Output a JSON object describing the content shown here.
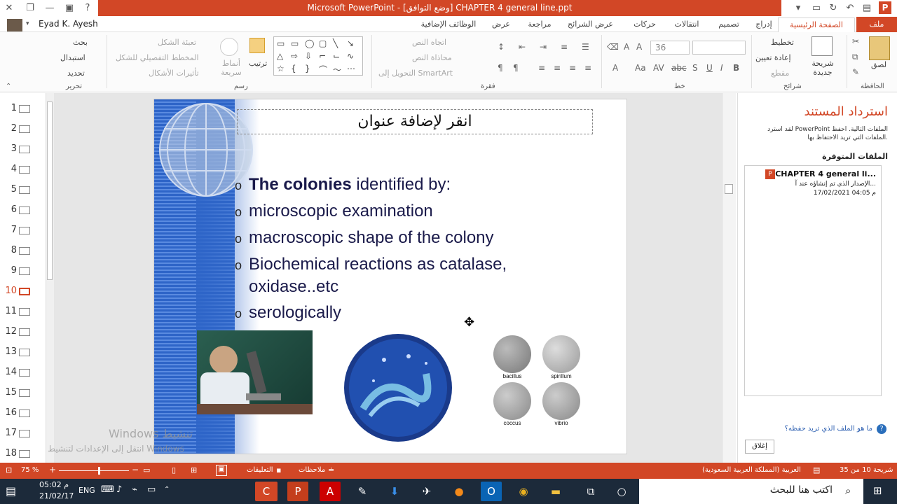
{
  "window": {
    "title": "Microsoft PowerPoint  - [وضع التوافق] CHAPTER  4 general line.ppt",
    "user": "Eyad K. Ayesh"
  },
  "tabs": [
    {
      "label": "ملف"
    },
    {
      "label": "الصفحة الرئيسية"
    },
    {
      "label": "إدراج"
    },
    {
      "label": "تصميم"
    },
    {
      "label": "انتقالات"
    },
    {
      "label": "حركات"
    },
    {
      "label": "عرض الشرائح"
    },
    {
      "label": "مراجعة"
    },
    {
      "label": "عرض"
    },
    {
      "label": "الوظائف الإضافية"
    }
  ],
  "ribbon": {
    "clipboard": {
      "paste": "لصق",
      "group": "الحافظة"
    },
    "slides": {
      "new_slide": "شريحة جديدة",
      "layout": "تخطيط",
      "reset": "إعادة تعيين",
      "section": "مقطع",
      "group": "شرائح"
    },
    "font": {
      "size": "36",
      "group": "خط",
      "bold": "B",
      "italic": "I",
      "underline": "U",
      "shadow": "S",
      "strike": "abc"
    },
    "paragraph": {
      "text_dir": "اتجاه النص",
      "align_text": "محاذاة النص",
      "smartart": "التحويل إلى SmartArt",
      "group": "فقرة"
    },
    "drawing": {
      "arrange": "ترتيب",
      "quick_styles": "أنماط سريعة",
      "fill": "تعبئة الشكل",
      "outline": "المخطط التفصيلي للشكل",
      "effects": "تأثيرات الأشكال",
      "group": "رسم"
    },
    "editing": {
      "find": "بحث",
      "replace": "استبدال",
      "select": "تحديد",
      "group": "تحرير"
    }
  },
  "thumbnails": [
    1,
    2,
    3,
    4,
    5,
    6,
    7,
    8,
    9,
    10,
    11,
    12,
    13,
    14,
    15,
    16,
    17,
    18
  ],
  "current_slide": 10,
  "slide": {
    "title_placeholder": "انقر لإضافة عنوان",
    "bullets": [
      {
        "bold": "The colonies",
        "rest": " identified by:"
      },
      {
        "bold": "",
        "rest": "microscopic examination"
      },
      {
        "bold": "",
        "rest": "macroscopic shape of the colony"
      },
      {
        "bold": "",
        "rest": " Biochemical reactions as catalase,"
      },
      {
        "bold": "",
        "rest": "oxidase..etc"
      },
      {
        "bold": "",
        "rest": "serologically"
      }
    ],
    "bacteria_labels": [
      "bacillus",
      "spirillum",
      "coccus",
      "vibrio"
    ],
    "watermark": [
      "Windows تنشيط",
      "انتقل إلى الإعدادات لتنشيط Windows"
    ]
  },
  "recovery": {
    "title": "استرداد المستند",
    "desc": "لقد استرد PowerPoint الملفات التالية. احفظ الملفات التي تريد الاحتفاظ بها.",
    "available": "الملفات المتوفرة",
    "file_name": "CHAPTER  4 general li...",
    "file_desc": "الإصدار الذي تم إنشاؤه عند آ...",
    "file_time": "17/02/2021 04:05 م",
    "help": "ما هو الملف الذي تريد حفظه؟",
    "close": "إغلاق"
  },
  "status": {
    "slide_info": "شريحة 10 من 35",
    "language": "العربية (المملكة العربية السعودية)",
    "notes": "ملاحظات",
    "comments": "التعليقات",
    "zoom": "75 %"
  },
  "taskbar": {
    "search": "اكتب هنا للبحث",
    "time": "05:02 م",
    "date": "21/02/17",
    "lang": "ENG"
  }
}
